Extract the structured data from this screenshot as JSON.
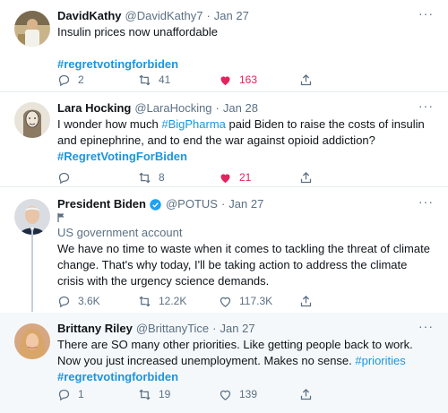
{
  "tweets": [
    {
      "name": "DavidKathy",
      "handle": "@DavidKathy7",
      "date": "Jan 27",
      "text": "Insulin prices now unaffordable",
      "hashtag": "#regretvotingforbiden",
      "replies": "2",
      "retweets": "41",
      "likes": "163"
    },
    {
      "name": "Lara Hocking",
      "handle": "@LaraHocking",
      "date": "Jan 28",
      "text_before": "I wonder how much ",
      "text_link": "#BigPharma",
      "text_after": " paid Biden to raise the costs of insulin and epinephrine, and to end the war against opioid addiction?",
      "hashtag": "#RegretVotingForBiden",
      "retweets": "8",
      "likes": "21"
    },
    {
      "name": "President Biden",
      "handle": "@POTUS",
      "date": "Jan 27",
      "account_label": "US government account",
      "text": "We have no time to waste when it comes to tackling the threat of climate change. That's why today, I'll be taking action to address the climate crisis with the urgency science demands.",
      "replies": "3.6K",
      "retweets": "12.2K",
      "likes": "117.3K"
    },
    {
      "name": "Brittany Riley",
      "handle": "@BrittanyTice",
      "date": "Jan 27",
      "text_before": "There are SO many other priorities. Like getting people back to work. Now you just increased unemployment. Makes no sense. ",
      "text_link": "#priorities",
      "hashtag": "#regretvotingforbiden",
      "replies": "1",
      "retweets": "19",
      "likes": "139"
    }
  ],
  "colors": {
    "link": "#1b95e0",
    "like_active": "#e0245e",
    "muted": "#5b7083",
    "verified": "#1da1f2"
  }
}
